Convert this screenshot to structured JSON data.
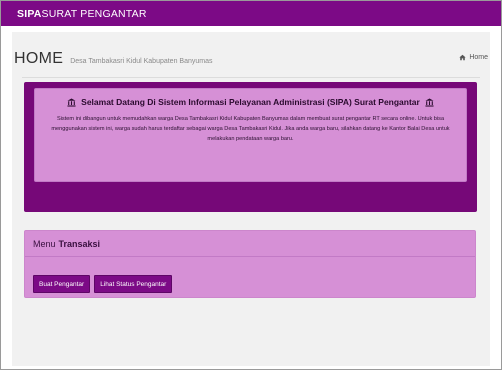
{
  "navbar": {
    "brand_bold": "SIPA",
    "brand_rest": "SURAT PENGANTAR"
  },
  "header": {
    "title": "HOME",
    "subtitle": "Desa Tambakasri Kidul Kabupaten Banyumas",
    "breadcrumb": "Home",
    "breadcrumb_icon": "home-icon"
  },
  "welcome": {
    "title": "Selamat Datang Di Sistem Informasi Pelayanan Administrasi (SIPA) Surat Pengantar",
    "title_icon": "bank-icon",
    "body": "Sistem ini dibangun untuk memudahkan warga Desa Tambakasri Kidul Kabupaten Banyumas dalam membuat surat pengantar RT secara online. Untuk bisa menggunakan sistem ini, warga sudah harus terdaftar sebagai warga Desa Tambakasri Kidul. Jika anda warga baru, silahkan datang ke Kantor Balai Desa untuk melakukan pendataan warga baru."
  },
  "menu": {
    "label": "Menu",
    "title": "Transaksi",
    "buttons": [
      "Buat Pengantar",
      "Lihat Status Pengantar"
    ]
  },
  "colors": {
    "primary": "#7c0a86",
    "panel": "#d690d6",
    "dark_box": "#760878"
  }
}
